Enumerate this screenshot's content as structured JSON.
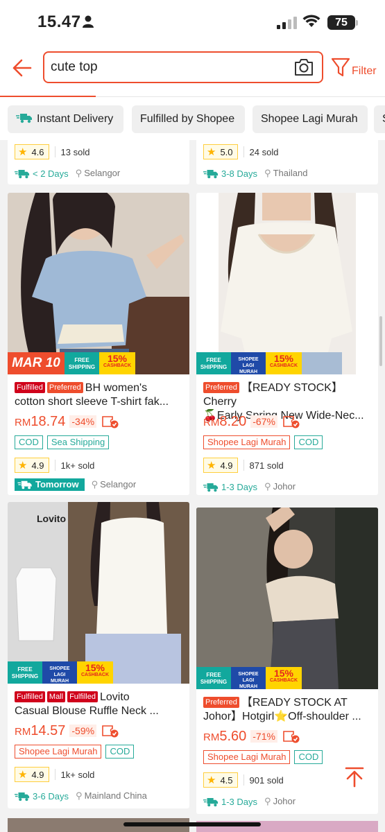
{
  "status_bar": {
    "time": "15.47",
    "battery": "75"
  },
  "search": {
    "query": "cute top",
    "filter_label": "Filter"
  },
  "filter_chips": [
    "Instant Delivery",
    "Fulfilled by Shopee",
    "Shopee Lagi Murah",
    "S"
  ],
  "top_partial_cards": [
    {
      "rating": "4.6",
      "sold": "13 sold",
      "delivery": "< 2 Days",
      "location": "Selangor"
    },
    {
      "rating": "5.0",
      "sold": "24 sold",
      "delivery": "3-8 Days",
      "location": "Thailand"
    }
  ],
  "banner_text": {
    "mar10": "MAR 10",
    "free_shipping_1": "FREE",
    "free_shipping_2": "SHIPPING",
    "lagi_1": "SHOPEE",
    "lagi_2": "LAGI",
    "lagi_3": "MURAH",
    "cashback_pct": "15%",
    "cashback_word": "CASHBACK"
  },
  "products": [
    {
      "tags": [
        "Fulfilled",
        "Preferred"
      ],
      "title_line1": "BH women's",
      "title_line2": "cotton short sleeve T-shirt fak...",
      "currency": "RM",
      "price": "18.74",
      "discount": "-34%",
      "labels": [
        "COD",
        "Sea Shipping"
      ],
      "rating": "4.9",
      "sold": "1k+ sold",
      "delivery": "Tomorrow",
      "location": "Selangor"
    },
    {
      "tags": [
        "Preferred"
      ],
      "title_line1": "【READY STOCK】Cherry",
      "title_line2": "🍒Early Spring New Wide-Nec...",
      "currency": "RM",
      "price": "8.20",
      "discount": "-67%",
      "labels": [
        "Shopee Lagi Murah",
        "COD"
      ],
      "rating": "4.9",
      "sold": "871 sold",
      "delivery": "1-3 Days",
      "location": "Johor"
    },
    {
      "tags": [
        "Fulfilled",
        "Mall",
        "Fulfilled"
      ],
      "title_line1": "Lovito",
      "title_line2": "Casual Blouse Ruffle Neck ...",
      "currency": "RM",
      "price": "14.57",
      "discount": "-59%",
      "labels": [
        "Shopee Lagi Murah",
        "COD"
      ],
      "rating": "4.9",
      "sold": "1k+ sold",
      "delivery": "3-6 Days",
      "location": "Mainland China",
      "image_brand": "Lovito"
    },
    {
      "tags": [
        "Preferred"
      ],
      "title_line1": "【READY STOCK AT",
      "title_line2": "Johor】Hotgirl⭐Off-shoulder ...",
      "currency": "RM",
      "price": "5.60",
      "discount": "-71%",
      "labels": [
        "Shopee Lagi Murah",
        "COD"
      ],
      "rating": "4.5",
      "sold": "901 sold",
      "delivery": "1-3 Days",
      "location": "Johor"
    }
  ],
  "colors": {
    "brand": "#ee4d2d",
    "teal": "#26aa99",
    "star": "#ffb400"
  }
}
